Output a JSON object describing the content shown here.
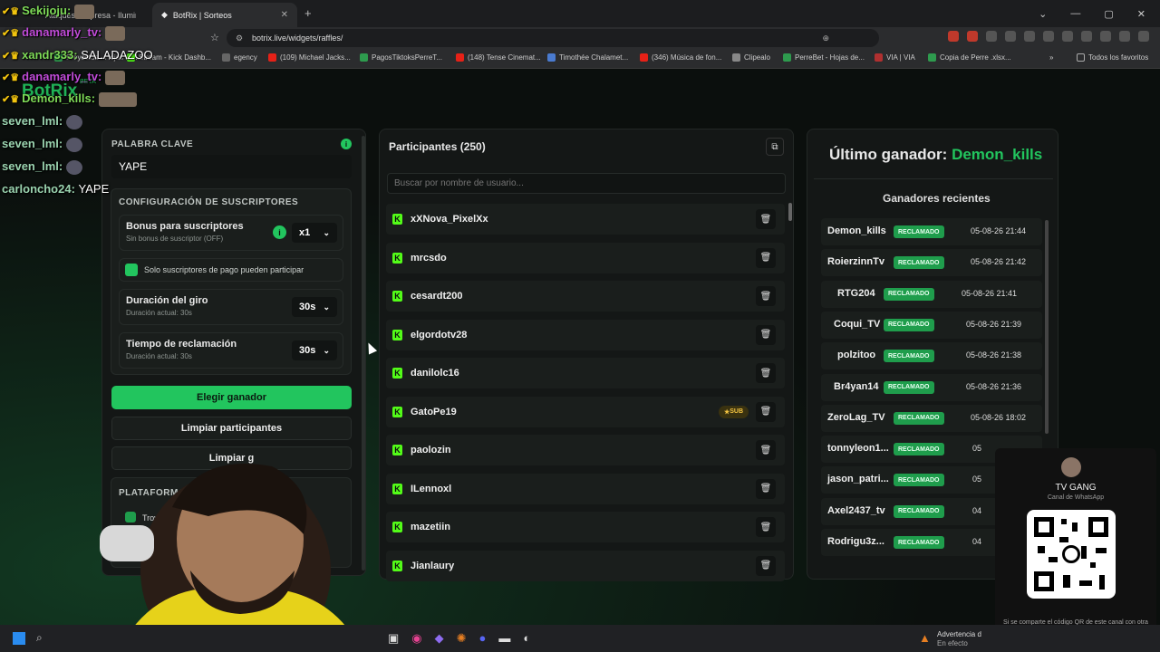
{
  "browser": {
    "tab1": "Ataques Sorpresa - Iluminenos",
    "tab2": "BotRix | Sorteos",
    "url": "botrix.live/widgets/raffles/",
    "bookmarks": [
      "Proyectos - Hojas de...",
      "Stream - Kick Dashb...",
      "egency",
      "(109) Michael Jacks...",
      "PagosTiktoksPerreT...",
      "(148) Tense Cinemat...",
      "Timothée Chalamet...",
      "(346) Música de fon...",
      "Clipealo",
      "PerreBet - Hojas de...",
      "VIA | VIA",
      "Copia de Perre .xlsx..."
    ],
    "all_favorites": "Todos los favoritos"
  },
  "chat": [
    {
      "user": "Sekijoju:",
      "text": "",
      "color": "#7dd957"
    },
    {
      "user": "danamarly_tv:",
      "text": "",
      "color": "#c04bd8"
    },
    {
      "user": "xandr333:",
      "text": "SALADAZOO",
      "color": "#7dd957"
    },
    {
      "user": "danamarly_tv:",
      "text": "",
      "color": "#c04bd8"
    },
    {
      "user": "Demon_kills:",
      "text": "",
      "color": "#7dd957"
    },
    {
      "user": "seven_lml:",
      "text": "",
      "color": "#9bd4b0"
    },
    {
      "user": "seven_lml:",
      "text": "",
      "color": "#9bd4b0"
    },
    {
      "user": "seven_lml:",
      "text": "",
      "color": "#9bd4b0"
    },
    {
      "user": "carloncho24:",
      "text": "YAPE",
      "color": "#9bd4b0"
    }
  ],
  "brand": {
    "name": "BotRix",
    "beta": "BETA"
  },
  "config": {
    "keyword_label": "PALABRA CLAVE",
    "keyword_value": "YAPE",
    "subs_section": "CONFIGURACIÓN DE SUSCRIPTORES",
    "bonus_title": "Bonus para suscriptores",
    "bonus_sub": "Sin bonus de suscriptor (OFF)",
    "bonus_value": "x1",
    "paid_only": "Solo suscriptores de pago pueden participar",
    "spin_title": "Duración del giro",
    "spin_sub": "Duración actual: 30s",
    "spin_value": "30s",
    "claim_title": "Tiempo de reclamación",
    "claim_sub": "Duración actual: 30s",
    "claim_value": "30s",
    "pick_winner": "Elegir ganador",
    "clear_participants": "Limpiar participantes",
    "clear_other": "Limpiar g",
    "platforms": "PLATAFORMAS AC",
    "trovo": "Trovo"
  },
  "participants": {
    "title": "Participantes (250)",
    "search_placeholder": "Buscar por nombre de usuario...",
    "sub_badge": "SUB",
    "list": [
      "xXNova_PixelXx",
      "mrcsdo",
      "cesardt200",
      "elgordotv28",
      "danilolc16",
      "GatoPe19",
      "paolozin",
      "ILennoxl",
      "mazetiin",
      "Jianlaury"
    ]
  },
  "winners": {
    "last_label": "Último ganador:",
    "last_name": "Demon_kills",
    "recent_title": "Ganadores recientes",
    "claimed": "RECLAMADO",
    "list": [
      {
        "name": "Demon_kills",
        "date": "05-08-26 21:44"
      },
      {
        "name": "RoierzinnTv",
        "date": "05-08-26 21:42"
      },
      {
        "name": "RTG204",
        "date": "05-08-26 21:41"
      },
      {
        "name": "Coqui_TV",
        "date": "05-08-26 21:39"
      },
      {
        "name": "polzitoo",
        "date": "05-08-26 21:38"
      },
      {
        "name": "Br4yan14",
        "date": "05-08-26 21:36"
      },
      {
        "name": "ZeroLag_TV",
        "date": "05-08-26 18:02"
      },
      {
        "name": "tonnyleon1...",
        "date": "05"
      },
      {
        "name": "jason_patri...",
        "date": "05"
      },
      {
        "name": "Axel2437_tv",
        "date": "04"
      },
      {
        "name": "Rodrigu3z...",
        "date": "04"
      }
    ]
  },
  "whatsapp": {
    "channel": "TV GANG",
    "sub": "Canal de WhatsApp",
    "note": "Si se comparte el código QR de este canal con otra persona, esta podrá escanearlo con su cámara para ver y seguir tu canal."
  },
  "taskbar": {
    "warning_title": "Advertencia d",
    "warning_sub": "En efecto"
  },
  "colors": {
    "accent": "#22c55e",
    "kick": "#53fc18"
  }
}
